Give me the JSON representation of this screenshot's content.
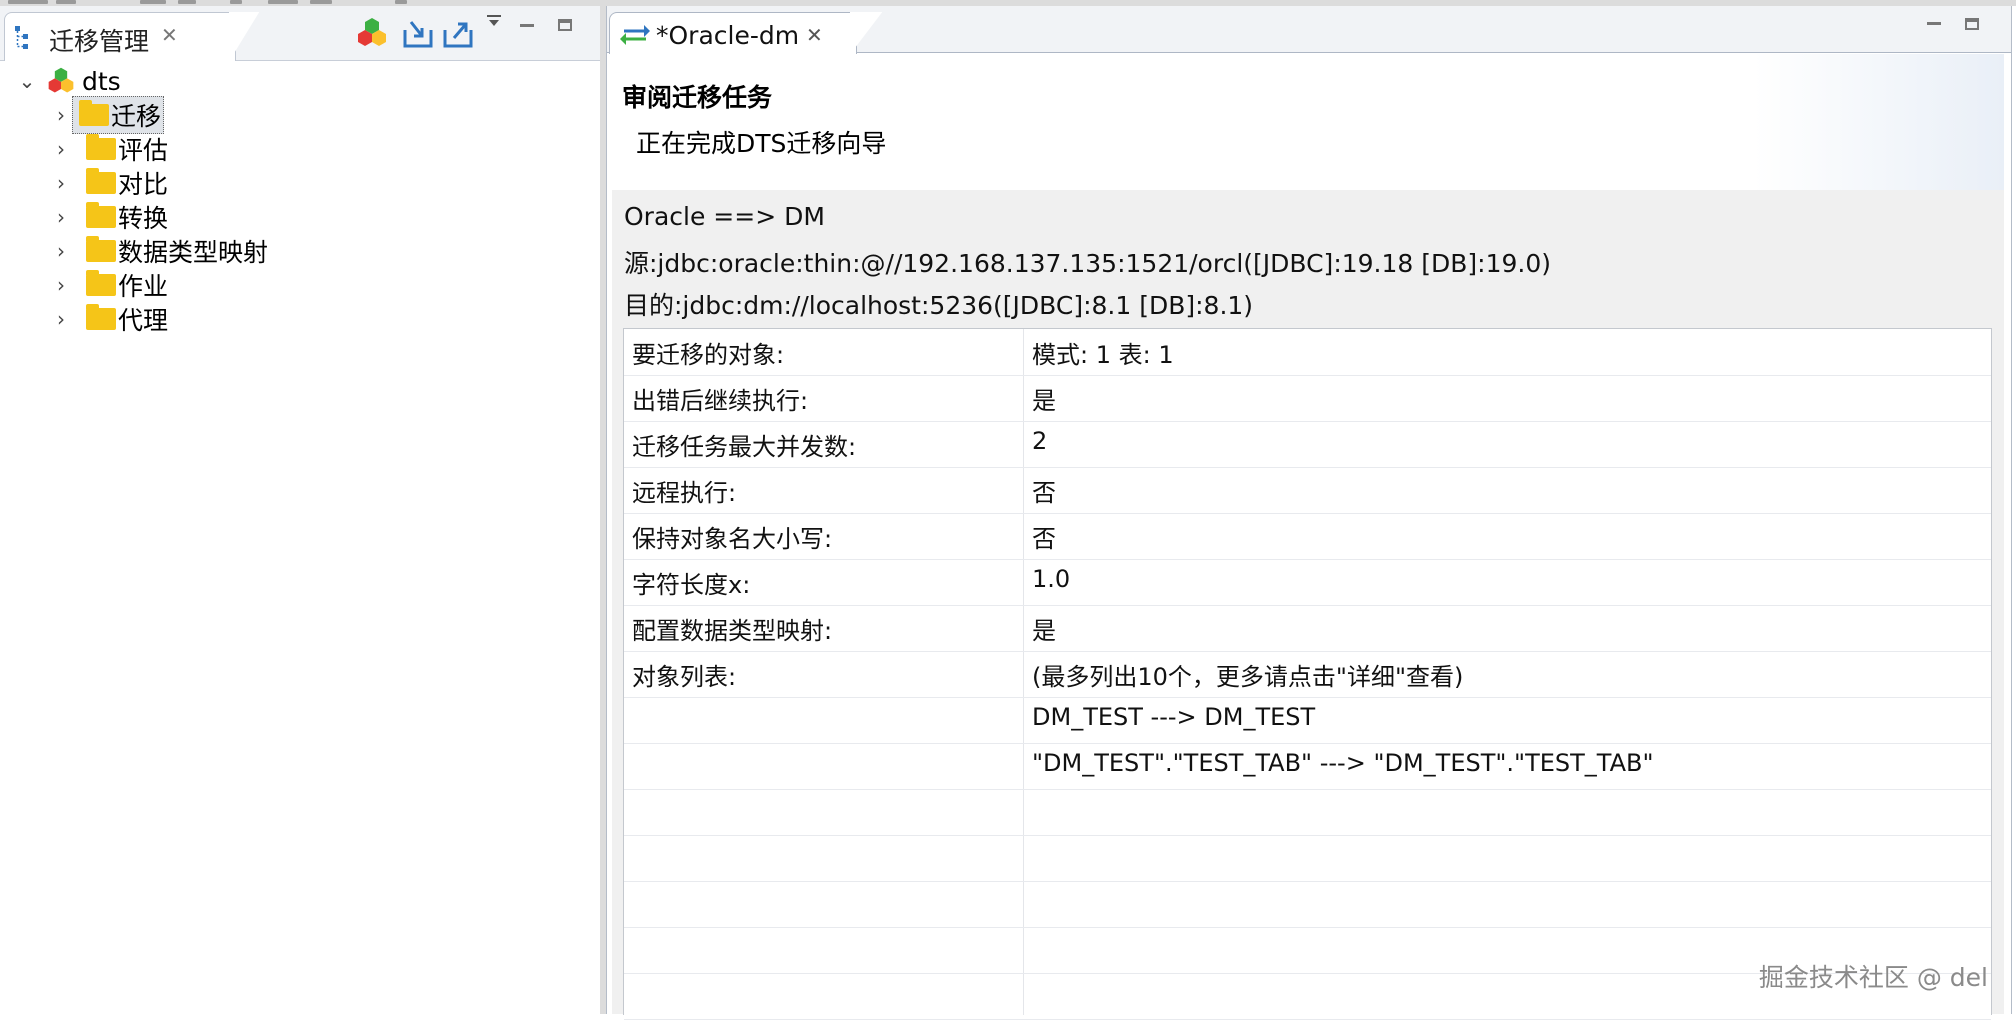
{
  "left_panel": {
    "tab_title": "迁移管理",
    "tree": {
      "root": "dts",
      "items": [
        {
          "label": "迁移",
          "selected": true
        },
        {
          "label": "评估"
        },
        {
          "label": "对比"
        },
        {
          "label": "转换"
        },
        {
          "label": "数据类型映射"
        },
        {
          "label": "作业"
        },
        {
          "label": "代理"
        }
      ]
    }
  },
  "editor": {
    "tab_title": "*Oracle-dm",
    "header_title": "审阅迁移任务",
    "header_subtitle": "正在完成DTS迁移向导",
    "info_lines": [
      "Oracle ==> DM",
      "源:jdbc:oracle:thin:@//192.168.137.135:1521/orcl([JDBC]:19.18 [DB]:19.0)",
      "目的:jdbc:dm://localhost:5236([JDBC]:8.1 [DB]:8.1)"
    ],
    "rows": [
      {
        "label": "要迁移的对象:",
        "value": "模式: 1 表: 1"
      },
      {
        "label": "出错后继续执行:",
        "value": "是"
      },
      {
        "label": "迁移任务最大并发数:",
        "value": "2"
      },
      {
        "label": "远程执行:",
        "value": "否"
      },
      {
        "label": "保持对象名大小写:",
        "value": "否"
      },
      {
        "label": "字符长度x:",
        "value": "1.0"
      },
      {
        "label": "配置数据类型映射:",
        "value": "是"
      },
      {
        "label": "对象列表:",
        "value": "(最多列出10个，更多请点击\"详细\"查看)"
      },
      {
        "label": "",
        "value": "DM_TEST ---> DM_TEST"
      },
      {
        "label": "",
        "value": "\"DM_TEST\".\"TEST_TAB\" ---> \"DM_TEST\".\"TEST_TAB\""
      },
      {
        "label": "",
        "value": ""
      },
      {
        "label": "",
        "value": ""
      },
      {
        "label": "",
        "value": ""
      },
      {
        "label": "",
        "value": ""
      },
      {
        "label": "",
        "value": ""
      }
    ]
  },
  "watermark": "掘金技术社区 @ del",
  "icons": {
    "tab_icon": "tree-nodes-icon",
    "root_icon": "dts-cluster-icon",
    "toolbar": [
      "dts-cluster-icon",
      "import-icon",
      "export-icon",
      "view-menu-icon"
    ],
    "editor_tab_icon": "swap-arrows-icon"
  },
  "colors": {
    "folder": "#f5c518",
    "tab_bar": "#f1f3f6",
    "info_bg": "#f0f0f0",
    "selection": "#dfe3e8"
  }
}
